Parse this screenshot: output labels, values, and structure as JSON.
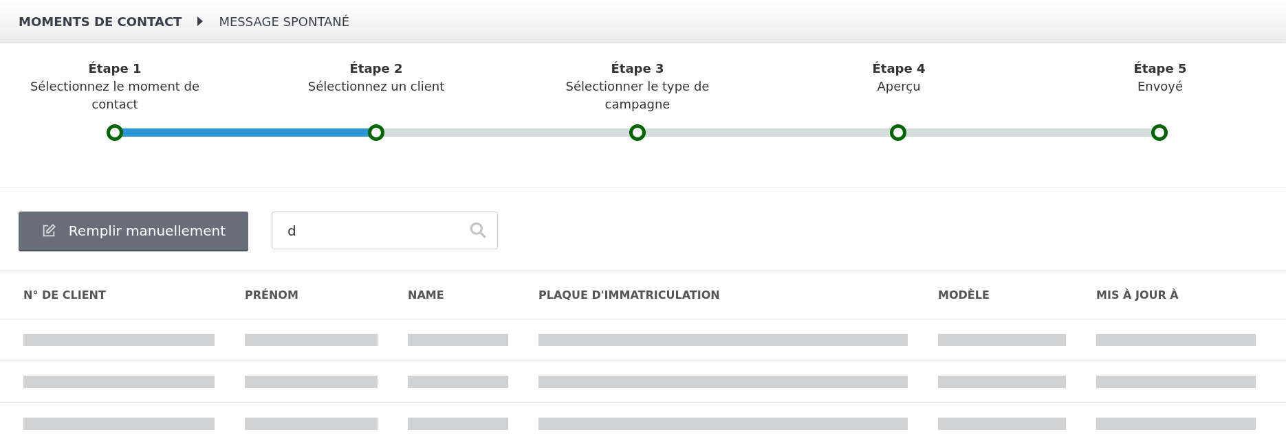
{
  "breadcrumb": [
    {
      "label": "MOMENTS DE CONTACT",
      "selected": false
    },
    {
      "label": "MESSAGE SPONTANÉ",
      "selected": true
    }
  ],
  "steps": [
    {
      "title": "Étape 1",
      "label": "Sélectionnez le moment de contact"
    },
    {
      "title": "Étape 2",
      "label": "Sélectionnez un client"
    },
    {
      "title": "Étape 3",
      "label": "Sélectionner le type de campagne"
    },
    {
      "title": "Étape 4",
      "label": "Aperçu"
    },
    {
      "title": "Étape 5",
      "label": "Envoyé"
    }
  ],
  "progress": {
    "level": 0.25
  },
  "manual_button": {
    "label": "Remplir manuellement"
  },
  "search": {
    "value": "d"
  },
  "table": {
    "columns": [
      "N° DE CLIENT",
      "PRÉNOM",
      "NAME",
      "PLAQUE D'IMMATRICULATION",
      "MODÈLE",
      "MIS À JOUR À"
    ],
    "rows": [
      {
        "kind": "placeholder"
      },
      {
        "kind": "placeholder"
      },
      {
        "kind": "placeholder"
      }
    ]
  }
}
